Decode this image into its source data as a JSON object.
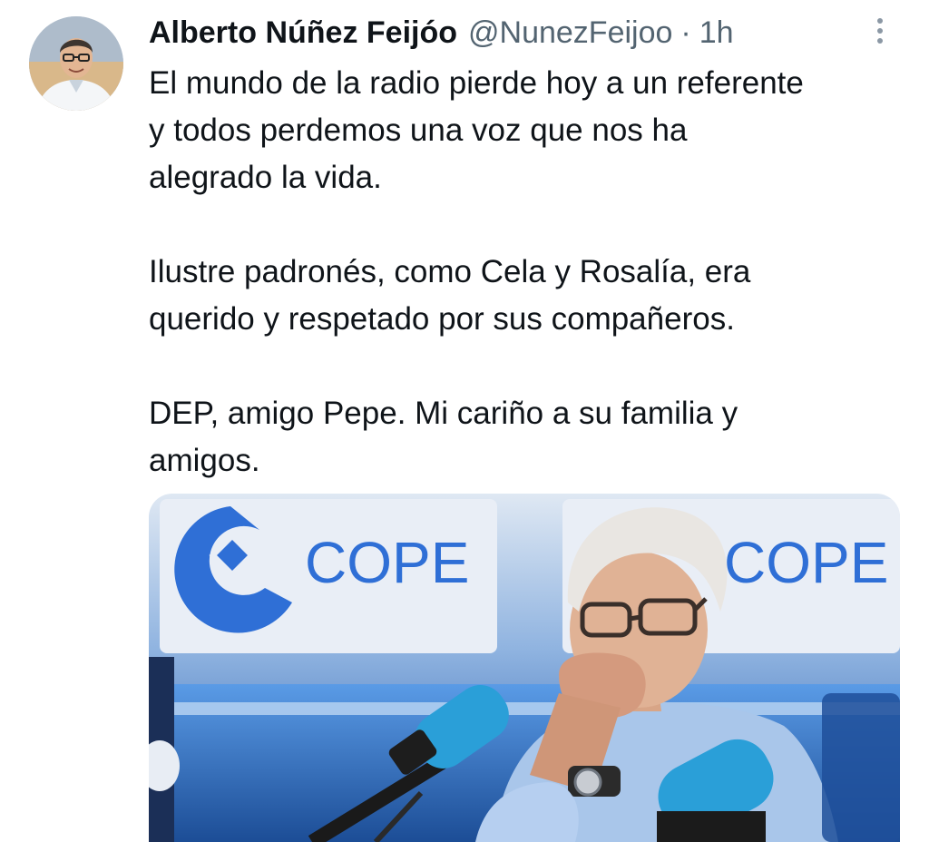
{
  "tweet": {
    "author": {
      "display_name": "Alberto Núñez Feijóo",
      "handle": "@NunezFeijoo",
      "separator": "·",
      "time": "1h"
    },
    "paragraphs": [
      [
        "El mundo de la radio pierde hoy a un referente",
        "y todos perdemos una voz que nos ha",
        "alegrado la vida."
      ],
      [
        "Ilustre padronés, como Cela y Rosalía, era",
        "querido y respetado por sus compañeros."
      ],
      [
        "DEP, amigo Pepe. Mi cariño a su familia y",
        "amigos."
      ]
    ],
    "media": {
      "sign_text_left": "COPE",
      "sign_text_right": "COPE",
      "colors": {
        "brand_blue": "#2f6fd6",
        "studio_blue": "#3e86de",
        "mic_blue": "#2a9fd8"
      }
    },
    "icons": {
      "more": "more-vertical-icon",
      "avatar": "profile-photo"
    }
  }
}
